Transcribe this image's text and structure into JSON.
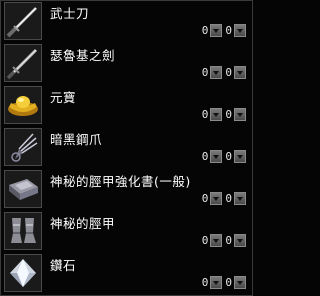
{
  "items": [
    {
      "name": "武士刀",
      "icon": "katana-icon",
      "count_a": "0",
      "count_b": "0"
    },
    {
      "name": "瑟魯基之劍",
      "icon": "sword-icon",
      "count_a": "0",
      "count_b": "0"
    },
    {
      "name": "元寶",
      "icon": "gold-ingot-icon",
      "count_a": "0",
      "count_b": "0"
    },
    {
      "name": "暗黑鋼爪",
      "icon": "claw-icon",
      "count_a": "0",
      "count_b": "0"
    },
    {
      "name": "神秘的脛甲強化書(一般)",
      "icon": "enchant-book-icon",
      "count_a": "0",
      "count_b": "0"
    },
    {
      "name": "神秘的脛甲",
      "icon": "greaves-icon",
      "count_a": "0",
      "count_b": "0"
    },
    {
      "name": "鑽石",
      "icon": "diamond-icon",
      "count_a": "0",
      "count_b": "0"
    }
  ]
}
